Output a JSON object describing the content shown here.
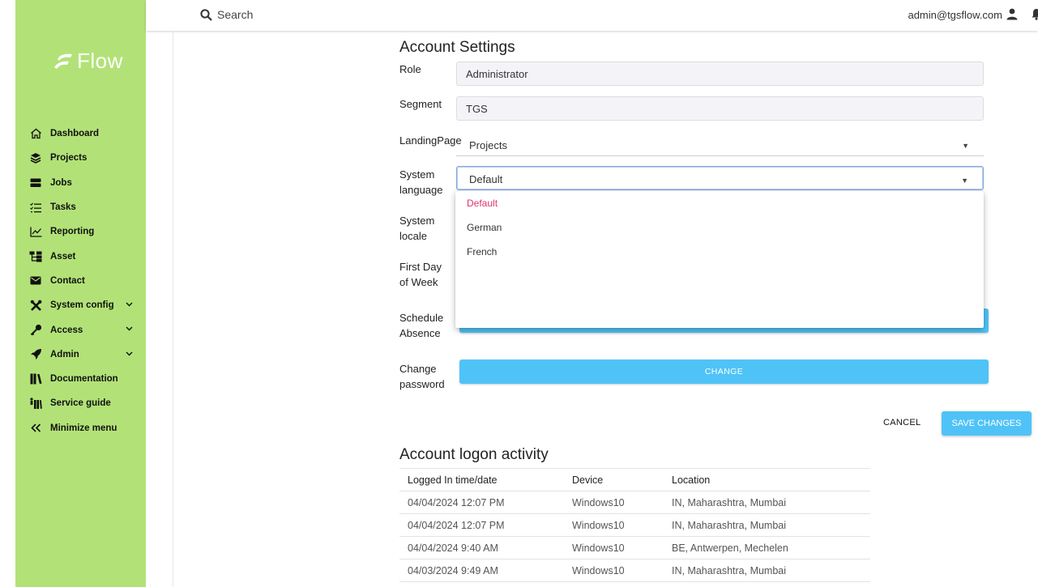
{
  "app": {
    "logo_text": "Flow"
  },
  "sidebar": {
    "items": [
      {
        "label": "Dashboard",
        "icon": "home-icon"
      },
      {
        "label": "Projects",
        "icon": "layers-icon"
      },
      {
        "label": "Jobs",
        "icon": "server-icon"
      },
      {
        "label": "Tasks",
        "icon": "checklist-icon"
      },
      {
        "label": "Reporting",
        "icon": "line-chart-icon"
      },
      {
        "label": "Asset",
        "icon": "hierarchy-icon"
      },
      {
        "label": "Contact",
        "icon": "envelope-icon"
      },
      {
        "label": "System config",
        "icon": "tools-icon"
      },
      {
        "label": "Access",
        "icon": "key-icon"
      },
      {
        "label": "Admin",
        "icon": "rocket-icon"
      },
      {
        "label": "Documentation",
        "icon": "books-icon"
      },
      {
        "label": "Service guide",
        "icon": "guide-icon"
      },
      {
        "label": "Minimize menu",
        "icon": "double-chevron-left-icon"
      }
    ]
  },
  "topbar": {
    "search_placeholder": "Search",
    "user_email": "admin@tgsflow.com"
  },
  "settings": {
    "title": "Account Settings",
    "role_label": "Role",
    "role_value": "Administrator",
    "segment_label": "Segment",
    "segment_value": "TGS",
    "landing_label": "LandingPage",
    "landing_value": "Projects",
    "language_label_1": "System",
    "language_label_2": "language",
    "language_value": "Default",
    "language_options": [
      "Default",
      "German",
      "French"
    ],
    "locale_label_1": "System",
    "locale_label_2": "locale",
    "firstday_label_1": "First Day",
    "firstday_label_2": "of Week",
    "absence_label_1": "Schedule",
    "absence_label_2": "Absence",
    "password_label_1": "Change",
    "password_label_2": "password",
    "change_button": "CHANGE",
    "cancel_button": "CANCEL",
    "save_button": "SAVE CHANGES"
  },
  "activity": {
    "title": "Account logon activity",
    "columns": [
      "Logged In time/date",
      "Device",
      "Location"
    ],
    "rows": [
      [
        "04/04/2024 12:07 PM",
        "Windows10",
        "IN, Maharashtra, Mumbai"
      ],
      [
        "04/04/2024 12:07 PM",
        "Windows10",
        "IN, Maharashtra, Mumbai"
      ],
      [
        "04/04/2024 9:40 AM",
        "Windows10",
        "BE, Antwerpen, Mechelen"
      ],
      [
        "04/03/2024 9:49 AM",
        "Windows10",
        "IN, Maharashtra, Mumbai"
      ]
    ]
  },
  "colors": {
    "sidebar_bg": "#b2e277",
    "accent_button": "#4fc3f7",
    "selected_option": "#e2336b"
  }
}
